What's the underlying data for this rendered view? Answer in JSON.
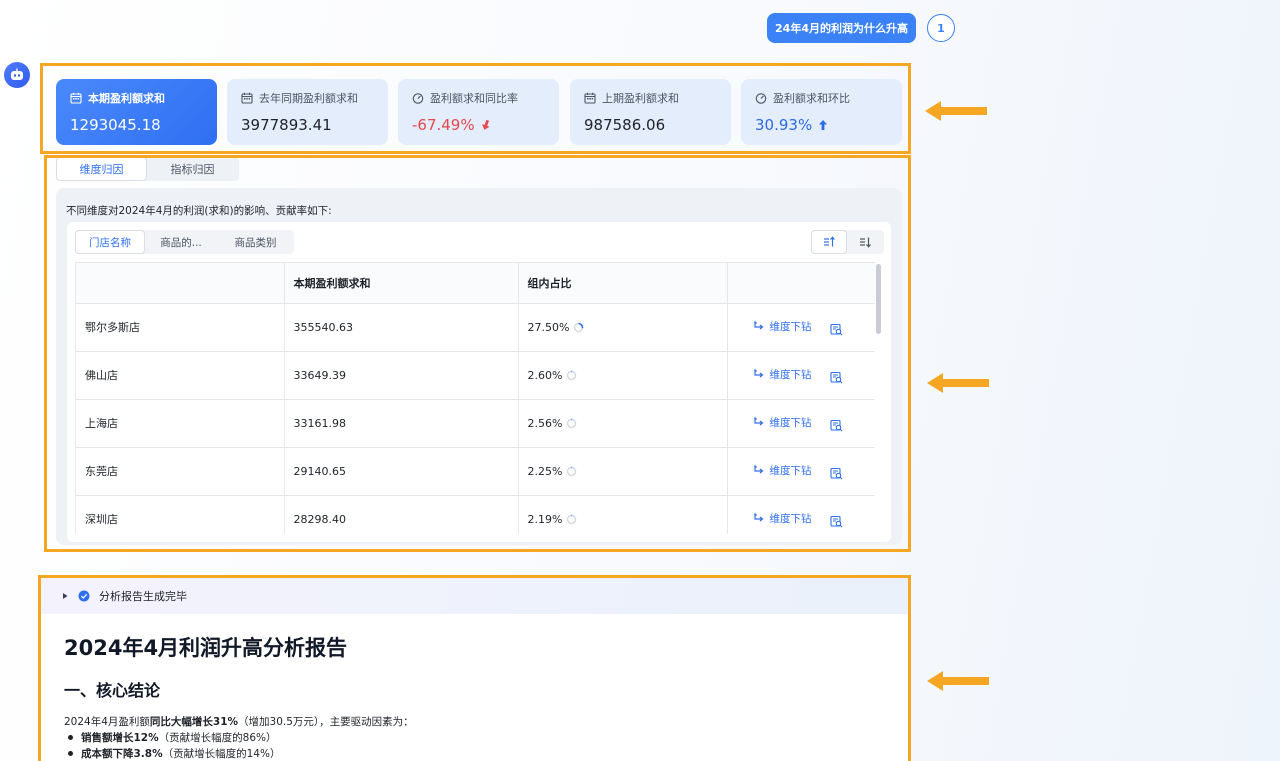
{
  "header": {
    "question": "24年4月的利润为什么升高",
    "page_number": "1"
  },
  "kpis": [
    {
      "label": "本期盈利额求和",
      "value": "1293045.18",
      "icon": "calendar-icon",
      "trend": ""
    },
    {
      "label": "去年同期盈利额求和",
      "value": "3977893.41",
      "icon": "calendar-icon",
      "trend": ""
    },
    {
      "label": "盈利额求和同比率",
      "value": "-67.49%",
      "icon": "gauge-icon",
      "trend": "down"
    },
    {
      "label": "上期盈利额求和",
      "value": "987586.06",
      "icon": "calendar-icon",
      "trend": ""
    },
    {
      "label": "盈利额求和环比",
      "value": "30.93%",
      "icon": "gauge-icon",
      "trend": "up"
    }
  ],
  "attribution_tabs": [
    "维度归因",
    "指标归因"
  ],
  "panel": {
    "description": "不同维度对2024年4月的利润(求和)的影响、贡献率如下:",
    "dimension_tabs": [
      "门店名称",
      "商品的...",
      "商品类别"
    ],
    "columns": [
      "",
      "本期盈利额求和",
      "组内占比",
      ""
    ],
    "drill_label": "维度下钻",
    "rows": [
      {
        "name": "鄂尔多斯店",
        "value": "355540.63",
        "share": "27.50%",
        "share_num": 0.275
      },
      {
        "name": "佛山店",
        "value": "33649.39",
        "share": "2.60%",
        "share_num": 0.026
      },
      {
        "name": "上海店",
        "value": "33161.98",
        "share": "2.56%",
        "share_num": 0.0256
      },
      {
        "name": "东莞店",
        "value": "29140.65",
        "share": "2.25%",
        "share_num": 0.0225
      },
      {
        "name": "深圳店",
        "value": "28298.40",
        "share": "2.19%",
        "share_num": 0.0219
      }
    ]
  },
  "report": {
    "status": "分析报告生成完毕",
    "title": "2024年4月利润升高分析报告",
    "section_title": "一、核心结论",
    "para_prefix": "2024年4月盈利额",
    "para_bold": "同比大幅增长31%",
    "para_suffix": "（增加30.5万元），主要驱动因素为：",
    "bullets": [
      {
        "bold": "销售额增长12%",
        "rest": "（贡献增长幅度的86%）"
      },
      {
        "bold": "成本额下降3.8%",
        "rest": "（贡献增长幅度的14%）"
      }
    ]
  },
  "colors": {
    "accent": "#2f6ff2",
    "annotation": "#f5a623",
    "negative": "#e5484d"
  }
}
